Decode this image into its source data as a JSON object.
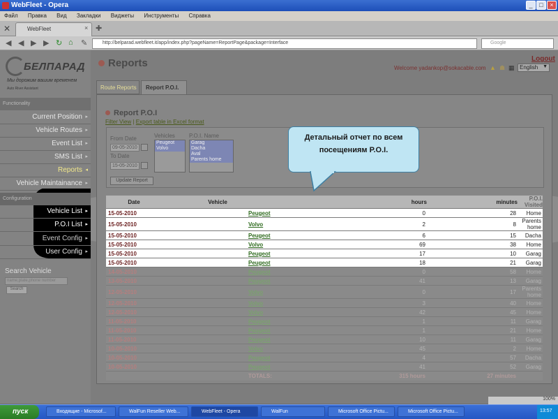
{
  "window": {
    "title": "WebFleet - Opera"
  },
  "menu": {
    "items": [
      "Файл",
      "Правка",
      "Вид",
      "Закладки",
      "Виджеты",
      "Инструменты",
      "Справка"
    ]
  },
  "browser": {
    "tab_title": "WebFleet",
    "address": "http://belparad.webfleet.it/app/index.php?pageName=ReportPage&package=Interface",
    "search_placeholder": "Google",
    "zoom": "100%"
  },
  "logo": {
    "name": "БЕЛПАРАД",
    "slogan": "Мы дорожим вашим временем",
    "sub": "Auto River Assistant"
  },
  "sidebar": {
    "section_functionality": "Functionality",
    "items": [
      {
        "label": "Current Position"
      },
      {
        "label": "Vehicle Routes"
      },
      {
        "label": "Event List"
      },
      {
        "label": "SMS List"
      },
      {
        "label": "Reports"
      },
      {
        "label": "Vehicle Maintainance"
      }
    ],
    "section_configuration": "Configuration",
    "config_items": [
      {
        "label": "Vehicle List"
      },
      {
        "label": "P.O.I List"
      },
      {
        "label": "Event Config"
      },
      {
        "label": "User Config"
      }
    ],
    "search": {
      "title": "Search Vehicle",
      "placeholder": "name,plate,phone number",
      "button": "Search"
    }
  },
  "header": {
    "title": "Reports",
    "logout": "Logout",
    "welcome": "Welcome yadankop@sokacable.com",
    "language": "English"
  },
  "tabs": [
    {
      "label": "Route Reports"
    },
    {
      "label": "Report P.O.I."
    }
  ],
  "report": {
    "title": "Report P.O.I",
    "filter_view": "Filter View",
    "export": "Export table in Excel format",
    "from_label": "From Date",
    "from_value": "09-05-2010",
    "to_label": "To Date",
    "to_value": "15-05-2010",
    "vehicles_label": "Vehicles",
    "vehicles": [
      "Peugeot",
      "Volvo"
    ],
    "poi_label": "P.O.I. Name",
    "poi_names": [
      "Garag",
      "Dacha",
      "Aval",
      "Parents home"
    ],
    "update_button": "Update Report"
  },
  "table": {
    "headers": [
      "Date",
      "Vehicle",
      "hours",
      "minutes",
      "P.O.I. Visited"
    ],
    "rows": [
      {
        "date": "15-05-2010",
        "vehicle": "Peugeot",
        "hours": "0",
        "minutes": "28",
        "poi": "Home"
      },
      {
        "date": "15-05-2010",
        "vehicle": "Volvo",
        "hours": "2",
        "minutes": "8",
        "poi": "Parents home"
      },
      {
        "date": "15-05-2010",
        "vehicle": "Peugeot",
        "hours": "6",
        "minutes": "15",
        "poi": "Dacha"
      },
      {
        "date": "15-05-2010",
        "vehicle": "Volvo",
        "hours": "69",
        "minutes": "38",
        "poi": "Home"
      },
      {
        "date": "15-05-2010",
        "vehicle": "Peugeot",
        "hours": "17",
        "minutes": "10",
        "poi": "Garag"
      },
      {
        "date": "15-05-2010",
        "vehicle": "Peugeot",
        "hours": "18",
        "minutes": "21",
        "poi": "Garag"
      },
      {
        "date": "14-05-2010",
        "vehicle": "Peugeot",
        "hours": "0",
        "minutes": "58",
        "poi": "Home"
      },
      {
        "date": "13-05-2010",
        "vehicle": "Peugeot",
        "hours": "41",
        "minutes": "13",
        "poi": "Garag"
      },
      {
        "date": "12-05-2010",
        "vehicle": "Volvo",
        "hours": "0",
        "minutes": "17",
        "poi": "Parents home"
      },
      {
        "date": "12-05-2010",
        "vehicle": "Volvo",
        "hours": "3",
        "minutes": "40",
        "poi": "Home"
      },
      {
        "date": "12-05-2010",
        "vehicle": "Volvo",
        "hours": "42",
        "minutes": "45",
        "poi": "Home"
      },
      {
        "date": "11-05-2010",
        "vehicle": "Peugeot",
        "hours": "1",
        "minutes": "11",
        "poi": "Garag"
      },
      {
        "date": "11-05-2010",
        "vehicle": "Peugeot",
        "hours": "1",
        "minutes": "21",
        "poi": "Home"
      },
      {
        "date": "11-05-2010",
        "vehicle": "Peugeot",
        "hours": "10",
        "minutes": "11",
        "poi": "Garag"
      },
      {
        "date": "10-05-2010",
        "vehicle": "Volvo",
        "hours": "45",
        "minutes": "2",
        "poi": "Home"
      },
      {
        "date": "10-05-2010",
        "vehicle": "Peugeot",
        "hours": "4",
        "minutes": "57",
        "poi": "Dacha"
      },
      {
        "date": "10-05-2010",
        "vehicle": "Peugeot",
        "hours": "41",
        "minutes": "52",
        "poi": "Garag"
      }
    ],
    "totals_label": "TOTALS:",
    "total_hours": "315 hours",
    "total_minutes": "27 minutes"
  },
  "callout": {
    "text": "Детальный отчет по всем посещениям P.O.I."
  },
  "taskbar": {
    "start": "пуск",
    "buttons": [
      "Входящие - Microsof...",
      "WalFun Reseller Web...",
      "WebFleet - Opera",
      "WalFun",
      "Microsoft Office Pictu...",
      "Microsoft Office Pictu..."
    ],
    "clock": "13:57"
  },
  "colors": {
    "titlebar": "#1d4fb8",
    "date_red": "#6b2020",
    "vehicle_green": "#2e6a1e",
    "callout": "#bfe5f3"
  }
}
